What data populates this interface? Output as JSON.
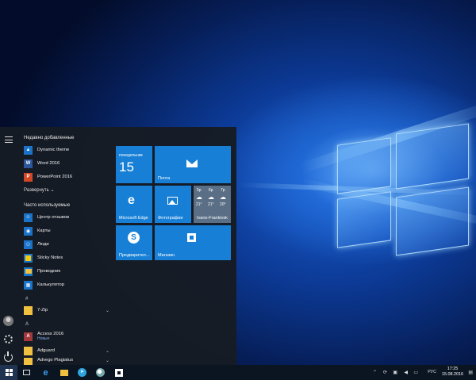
{
  "start_menu": {
    "recent_heading": "Недавно добавленные",
    "recent": [
      {
        "label": "Dynamic theme",
        "icon": "dynamic-theme-icon",
        "color": "#1a73c9"
      },
      {
        "label": "Word 2016",
        "icon": "word-icon",
        "color": "#2b579a",
        "glyph": "W"
      },
      {
        "label": "PowerPoint 2016",
        "icon": "powerpoint-icon",
        "color": "#d24726",
        "glyph": "P"
      }
    ],
    "expand_label": "Развернуть",
    "frequent_heading": "Часто используемые",
    "frequent": [
      {
        "label": "Центр отзывов",
        "icon": "feedback-hub-icon",
        "color": "#1a73c9"
      },
      {
        "label": "Карты",
        "icon": "maps-icon",
        "color": "#1a73c9"
      },
      {
        "label": "Люди",
        "icon": "people-icon",
        "color": "#1a73c9"
      },
      {
        "label": "Sticky Notes",
        "icon": "sticky-notes-icon",
        "color": "#f2c811"
      },
      {
        "label": "Проводник",
        "icon": "file-explorer-icon",
        "color": "#f0c040"
      },
      {
        "label": "Калькулятор",
        "icon": "calculator-icon",
        "color": "#1a73c9"
      }
    ],
    "group_hash": "#",
    "group_a": "A",
    "alpha": [
      {
        "label": "7-Zip",
        "icon": "folder-icon",
        "color": "#f0c040",
        "has_chevron": true
      },
      {
        "label": "Access 2016",
        "sub": "Новые",
        "icon": "access-icon",
        "color": "#a4373a",
        "glyph": "A"
      },
      {
        "label": "Adguard",
        "icon": "folder-icon",
        "color": "#f0c040",
        "has_chevron": true
      },
      {
        "label": "Advego Plagiatus",
        "icon": "folder-icon",
        "color": "#f0c040",
        "has_chevron": true
      }
    ]
  },
  "tiles": {
    "calendar_day": "понедельник",
    "calendar_date": "15",
    "mail": "Почта",
    "edge": "Microsoft Edge",
    "photos": "Фотографии",
    "weather_city": "Ivano-Frankivsk",
    "weather": [
      {
        "time": "5p",
        "temp": "21°"
      },
      {
        "time": "6p",
        "temp": "21°"
      },
      {
        "time": "7p",
        "temp": "20°"
      }
    ],
    "skype": "Предварител...",
    "store": "Магазин"
  },
  "taskbar": {
    "language": "РУС",
    "time": "17:25",
    "date": "15.08.2016"
  },
  "colors": {
    "tile_blue": "#1780d6",
    "menu_bg": "#161c24",
    "taskbar_bg": "#0b1522"
  }
}
